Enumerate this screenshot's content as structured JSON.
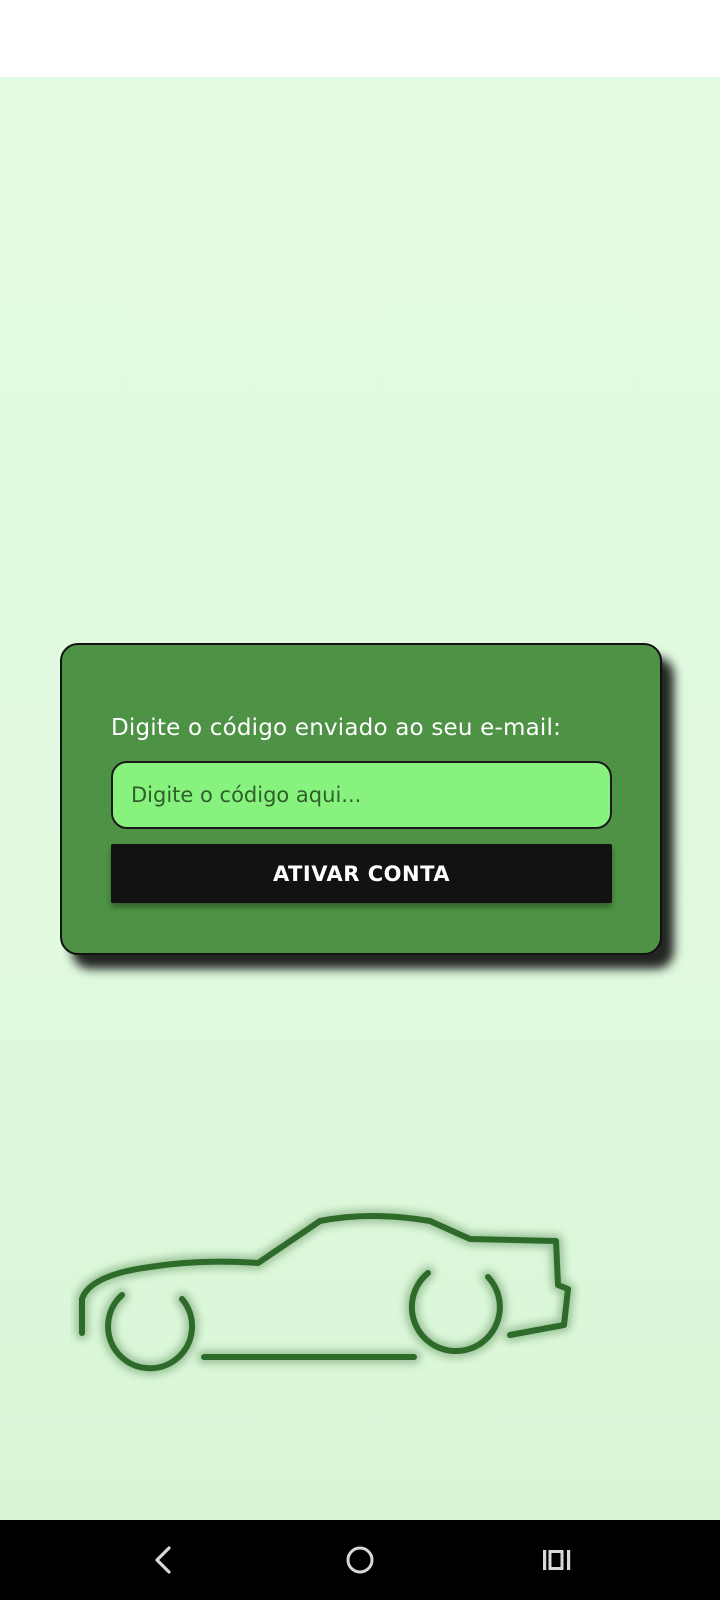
{
  "card": {
    "prompt": "Digite o código enviado ao seu e-mail:",
    "code_input": {
      "placeholder": "Digite o código aqui...",
      "value": ""
    },
    "activate_button": "ATIVAR CONTA"
  },
  "illustration": {
    "icon": "car-outline-icon",
    "color": "#2e6b2a"
  },
  "nav_bar": {
    "items": [
      "back-icon",
      "home-icon",
      "recents-icon"
    ]
  },
  "colors": {
    "background": "#e1fae1",
    "card": "#4e9345",
    "input": "#88f27e",
    "button": "#121212"
  }
}
